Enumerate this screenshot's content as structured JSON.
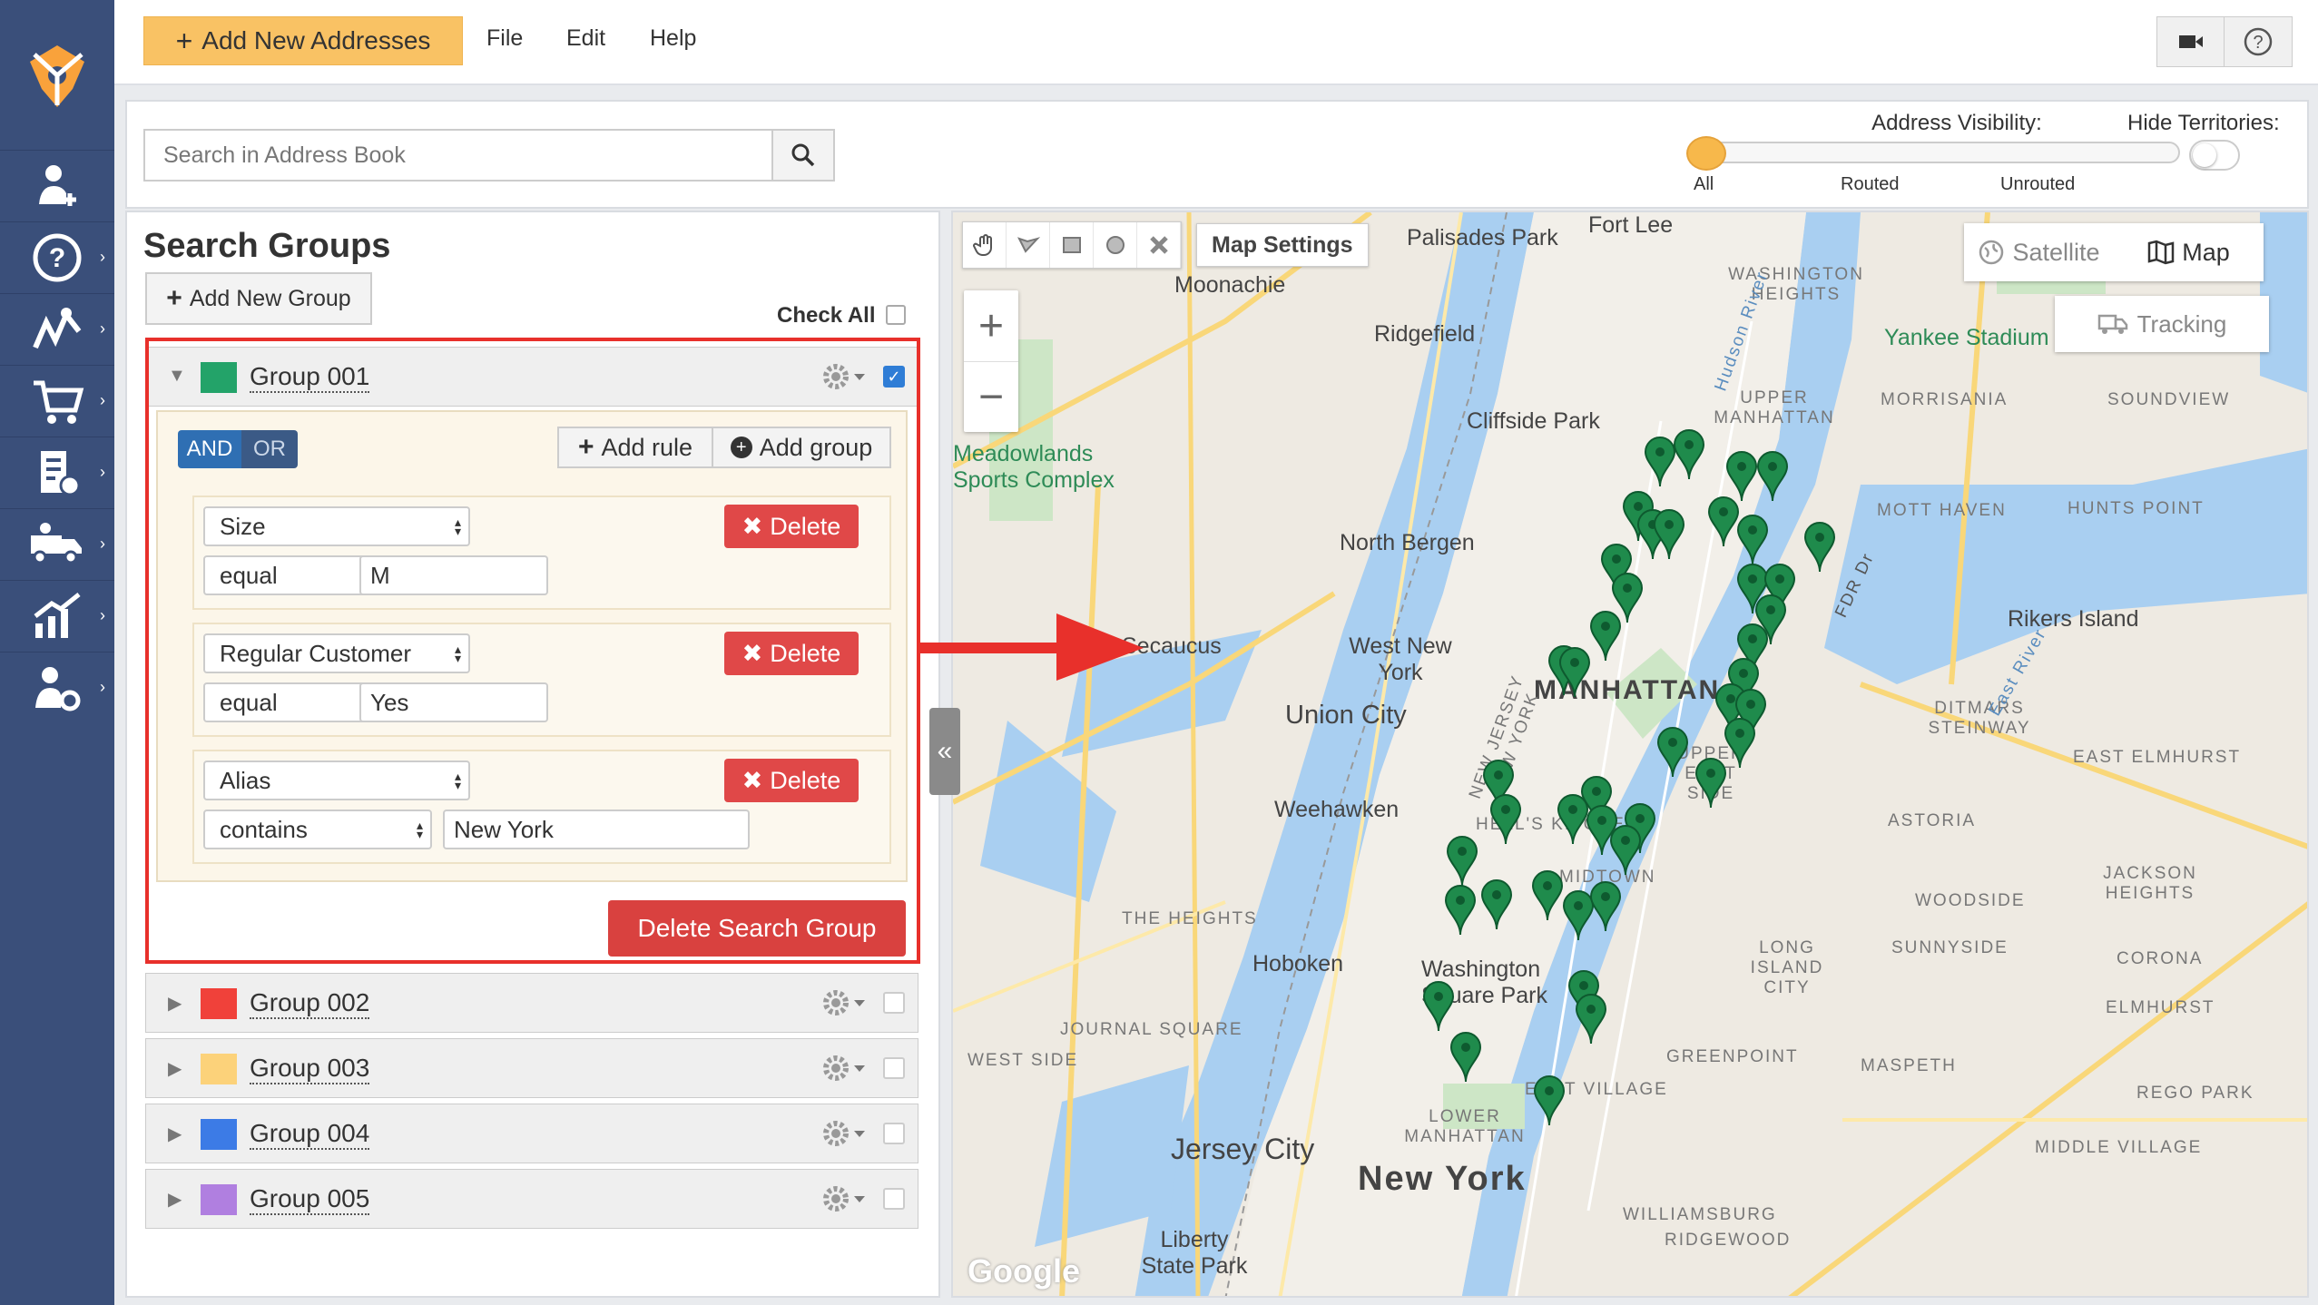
{
  "colors": {
    "nav_bg": "#3a4f7a",
    "accent_orange": "#f9c264",
    "danger_red": "#e04848",
    "group_colors": [
      "#23a369",
      "#f0413a",
      "#fcd27a",
      "#3c7be6",
      "#b07fe0"
    ],
    "pin_green": "#1f8b4c"
  },
  "nav": {
    "icons": [
      "logo-icon",
      "add-user-icon",
      "help-icon",
      "routes-icon",
      "cart-icon",
      "documents-icon",
      "fleet-icon",
      "analytics-icon",
      "settings-user-icon"
    ]
  },
  "topbar": {
    "add_addresses_label": "Add New Addresses",
    "menu": [
      "File",
      "Edit",
      "Help"
    ],
    "icons": [
      "video-icon",
      "help-circle-icon"
    ]
  },
  "search": {
    "placeholder": "Search in Address Book",
    "visibility_title": "Address Visibility:",
    "visibility_options": [
      "All",
      "Routed",
      "Unrouted"
    ],
    "visibility_value": "All",
    "hide_territories_label": "Hide Territories:",
    "hide_territories_on": false
  },
  "panel": {
    "title": "Search Groups",
    "add_group_label": "Add New Group",
    "check_all_label": "Check All",
    "groups": [
      {
        "name": "Group 001",
        "checked": true,
        "expanded": true
      },
      {
        "name": "Group 002",
        "checked": false,
        "expanded": false
      },
      {
        "name": "Group 003",
        "checked": false,
        "expanded": false
      },
      {
        "name": "Group 004",
        "checked": false,
        "expanded": false
      },
      {
        "name": "Group 005",
        "checked": false,
        "expanded": false
      }
    ],
    "rules_editor": {
      "and_label": "AND",
      "or_label": "OR",
      "selected_condition": "AND",
      "add_rule_label": "Add rule",
      "add_group_label": "Add group",
      "delete_label": "Delete",
      "rules": [
        {
          "field": "Size",
          "operator": "equal",
          "value": "M"
        },
        {
          "field": "Regular Customer",
          "operator": "equal",
          "value": "Yes"
        },
        {
          "field": "Alias",
          "operator": "contains",
          "value": "New York"
        }
      ]
    },
    "delete_search_group_label": "Delete Search Group"
  },
  "map": {
    "map_settings_label": "Map Settings",
    "satellite_label": "Satellite",
    "map_label": "Map",
    "selected_map_type": "Map",
    "tracking_label": "Tracking",
    "zoom_in": "+",
    "zoom_out": "−",
    "collapse_glyph": "«",
    "google_logo": "Google",
    "labels": [
      {
        "text": "Fort Lee",
        "style": "normal"
      },
      {
        "text": "Palisades Park",
        "style": "normal"
      },
      {
        "text": "Moonachie",
        "style": "normal"
      },
      {
        "text": "Ridgefield",
        "style": "normal"
      },
      {
        "text": "Cliffside Park",
        "style": "normal"
      },
      {
        "text": "North Bergen",
        "style": "normal"
      },
      {
        "text": "Secaucus",
        "style": "normal"
      },
      {
        "text": "West New York",
        "style": "normal"
      },
      {
        "text": "Union City",
        "style": "normal"
      },
      {
        "text": "Weehawken",
        "style": "normal"
      },
      {
        "text": "Hoboken",
        "style": "normal"
      },
      {
        "text": "Jersey City",
        "style": "normal"
      },
      {
        "text": "Liberty State Park",
        "style": "normal"
      },
      {
        "text": "Meadowlands Sports Complex",
        "style": "green"
      },
      {
        "text": "Yankee Stadium",
        "style": "green"
      },
      {
        "text": "Rikers Island",
        "style": "normal"
      },
      {
        "text": "MANHATTAN",
        "style": "big"
      },
      {
        "text": "New York",
        "style": "big"
      },
      {
        "text": "Washington Square Park",
        "style": "normal"
      },
      {
        "text": "WASHINGTON HEIGHTS",
        "style": "small"
      },
      {
        "text": "UPPER MANHATTAN",
        "style": "small"
      },
      {
        "text": "MORRISANIA",
        "style": "small"
      },
      {
        "text": "SOUNDVIEW",
        "style": "small"
      },
      {
        "text": "MOTT HAVEN",
        "style": "small"
      },
      {
        "text": "HUNTS POINT",
        "style": "small"
      },
      {
        "text": "DITMARS STEINWAY",
        "style": "small"
      },
      {
        "text": "EAST ELMHURST",
        "style": "small"
      },
      {
        "text": "ASTORIA",
        "style": "small"
      },
      {
        "text": "JACKSON HEIGHTS",
        "style": "small"
      },
      {
        "text": "WOODSIDE",
        "style": "small"
      },
      {
        "text": "LONG ISLAND CITY",
        "style": "small"
      },
      {
        "text": "SUNNYSIDE",
        "style": "small"
      },
      {
        "text": "CORONA",
        "style": "small"
      },
      {
        "text": "ELMHURST",
        "style": "small"
      },
      {
        "text": "MASPETH",
        "style": "small"
      },
      {
        "text": "GREENPOINT",
        "style": "small"
      },
      {
        "text": "REGO PARK",
        "style": "small"
      },
      {
        "text": "MIDDLE VILLAGE",
        "style": "small"
      },
      {
        "text": "WILLIAMSBURG",
        "style": "small"
      },
      {
        "text": "RIDGEWOOD",
        "style": "small"
      },
      {
        "text": "JOURNAL SQUARE",
        "style": "small"
      },
      {
        "text": "WEST SIDE",
        "style": "small"
      },
      {
        "text": "THE HEIGHTS",
        "style": "small"
      },
      {
        "text": "LOWER MANHATTAN",
        "style": "small"
      },
      {
        "text": "EAST VILLAGE",
        "style": "small"
      },
      {
        "text": "UPPER EAST SIDE",
        "style": "small"
      },
      {
        "text": "HELL'S KITCHEN",
        "style": "small"
      },
      {
        "text": "MIDTOWN",
        "style": "small"
      },
      {
        "text": "NEW JERSEY NEW YORK",
        "style": "small"
      },
      {
        "text": "Hudson River",
        "style": "water"
      },
      {
        "text": "East River",
        "style": "water"
      },
      {
        "text": "FDR Dr",
        "style": "road"
      }
    ]
  }
}
